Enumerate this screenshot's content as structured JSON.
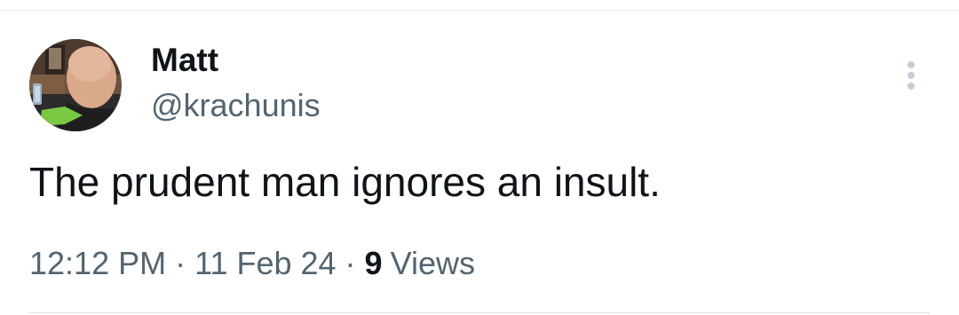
{
  "tweet": {
    "author_name": "Matt",
    "author_handle": "@krachunis",
    "avatar_icon": "user-avatar-photo",
    "more_icon": "more-vertical-icon",
    "text": "The prudent man ignores an insult.",
    "time": "12:12 PM",
    "date": "11 Feb 24",
    "separator": "·",
    "views_count": "9",
    "views_label": "Views"
  },
  "colors": {
    "text_primary": "#0f1419",
    "text_secondary": "#536471",
    "divider": "#e6e9ec",
    "icon_gray": "#c4cdd4"
  }
}
